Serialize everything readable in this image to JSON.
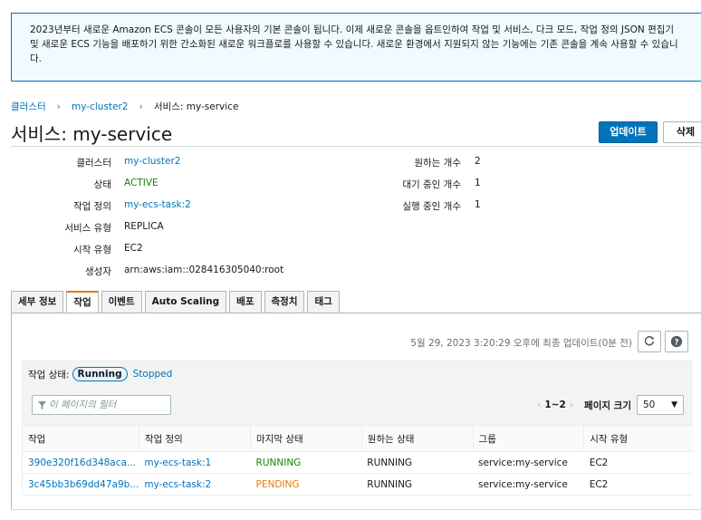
{
  "banner": {
    "text": "2023년부터 새로운 Amazon ECS 콘솔이 모든 사용자의 기본 콘솔이 됩니다. 이제 새로운 콘솔을 옵트인하여 작업 및 서비스, 다크 모드, 작업 정의 JSON 편집기 및 새로운 ECS 기능을 배포하기 위한 간소화된 새로운 워크플로를 사용할 수 있습니다. 새로운 환경에서 지원되지 않는 기능에는 기존 콘솔을 계속 사용할 수 있습니다."
  },
  "breadcrumb": {
    "clusters": "클러스터",
    "cluster": "my-cluster2",
    "current": "서비스: my-service"
  },
  "header": {
    "title": "서비스: my-service",
    "update_label": "업데이트",
    "delete_label": "삭제"
  },
  "details": {
    "left": [
      {
        "label": "클러스터",
        "value": "my-cluster2"
      },
      {
        "label": "상태",
        "value": "ACTIVE"
      },
      {
        "label": "작업 정의",
        "value": "my-ecs-task:2"
      },
      {
        "label": "서비스 유형",
        "value": "REPLICA"
      },
      {
        "label": "시작 유형",
        "value": "EC2"
      },
      {
        "label": "생성자",
        "value": "arn:aws:iam::028416305040:root"
      }
    ],
    "right": [
      {
        "label": "원하는 개수",
        "value": "2"
      },
      {
        "label": "대기 중인 개수",
        "value": "1"
      },
      {
        "label": "실행 중인 개수",
        "value": "1"
      }
    ]
  },
  "tabs": [
    "세부 정보",
    "작업",
    "이벤트",
    "Auto Scaling",
    "배포",
    "측정치",
    "태그"
  ],
  "tasks_panel": {
    "updated_text": "5월 29, 2023 3:20:29 오후에 최종 업데이트(0분 전)",
    "status_label": "작업 상태:",
    "running_label": "Running",
    "stopped_label": "Stopped",
    "filter_placeholder": "이 페이지의 필터",
    "range": "1~2",
    "page_size_label": "페이지 크기",
    "page_size": "50",
    "columns": [
      "작업",
      "작업 정의",
      "마지막 상태",
      "원하는 상태",
      "그룹",
      "시작 유형"
    ],
    "rows": [
      {
        "task": "390e320f16d348aca...",
        "taskdef": "my-ecs-task:1",
        "last": "RUNNING",
        "desired": "RUNNING",
        "group": "service:my-service",
        "launch": "EC2"
      },
      {
        "task": "3c45bb3b69dd47a9b...",
        "taskdef": "my-ecs-task:2",
        "last": "PENDING",
        "desired": "RUNNING",
        "group": "service:my-service",
        "launch": "EC2"
      }
    ]
  }
}
